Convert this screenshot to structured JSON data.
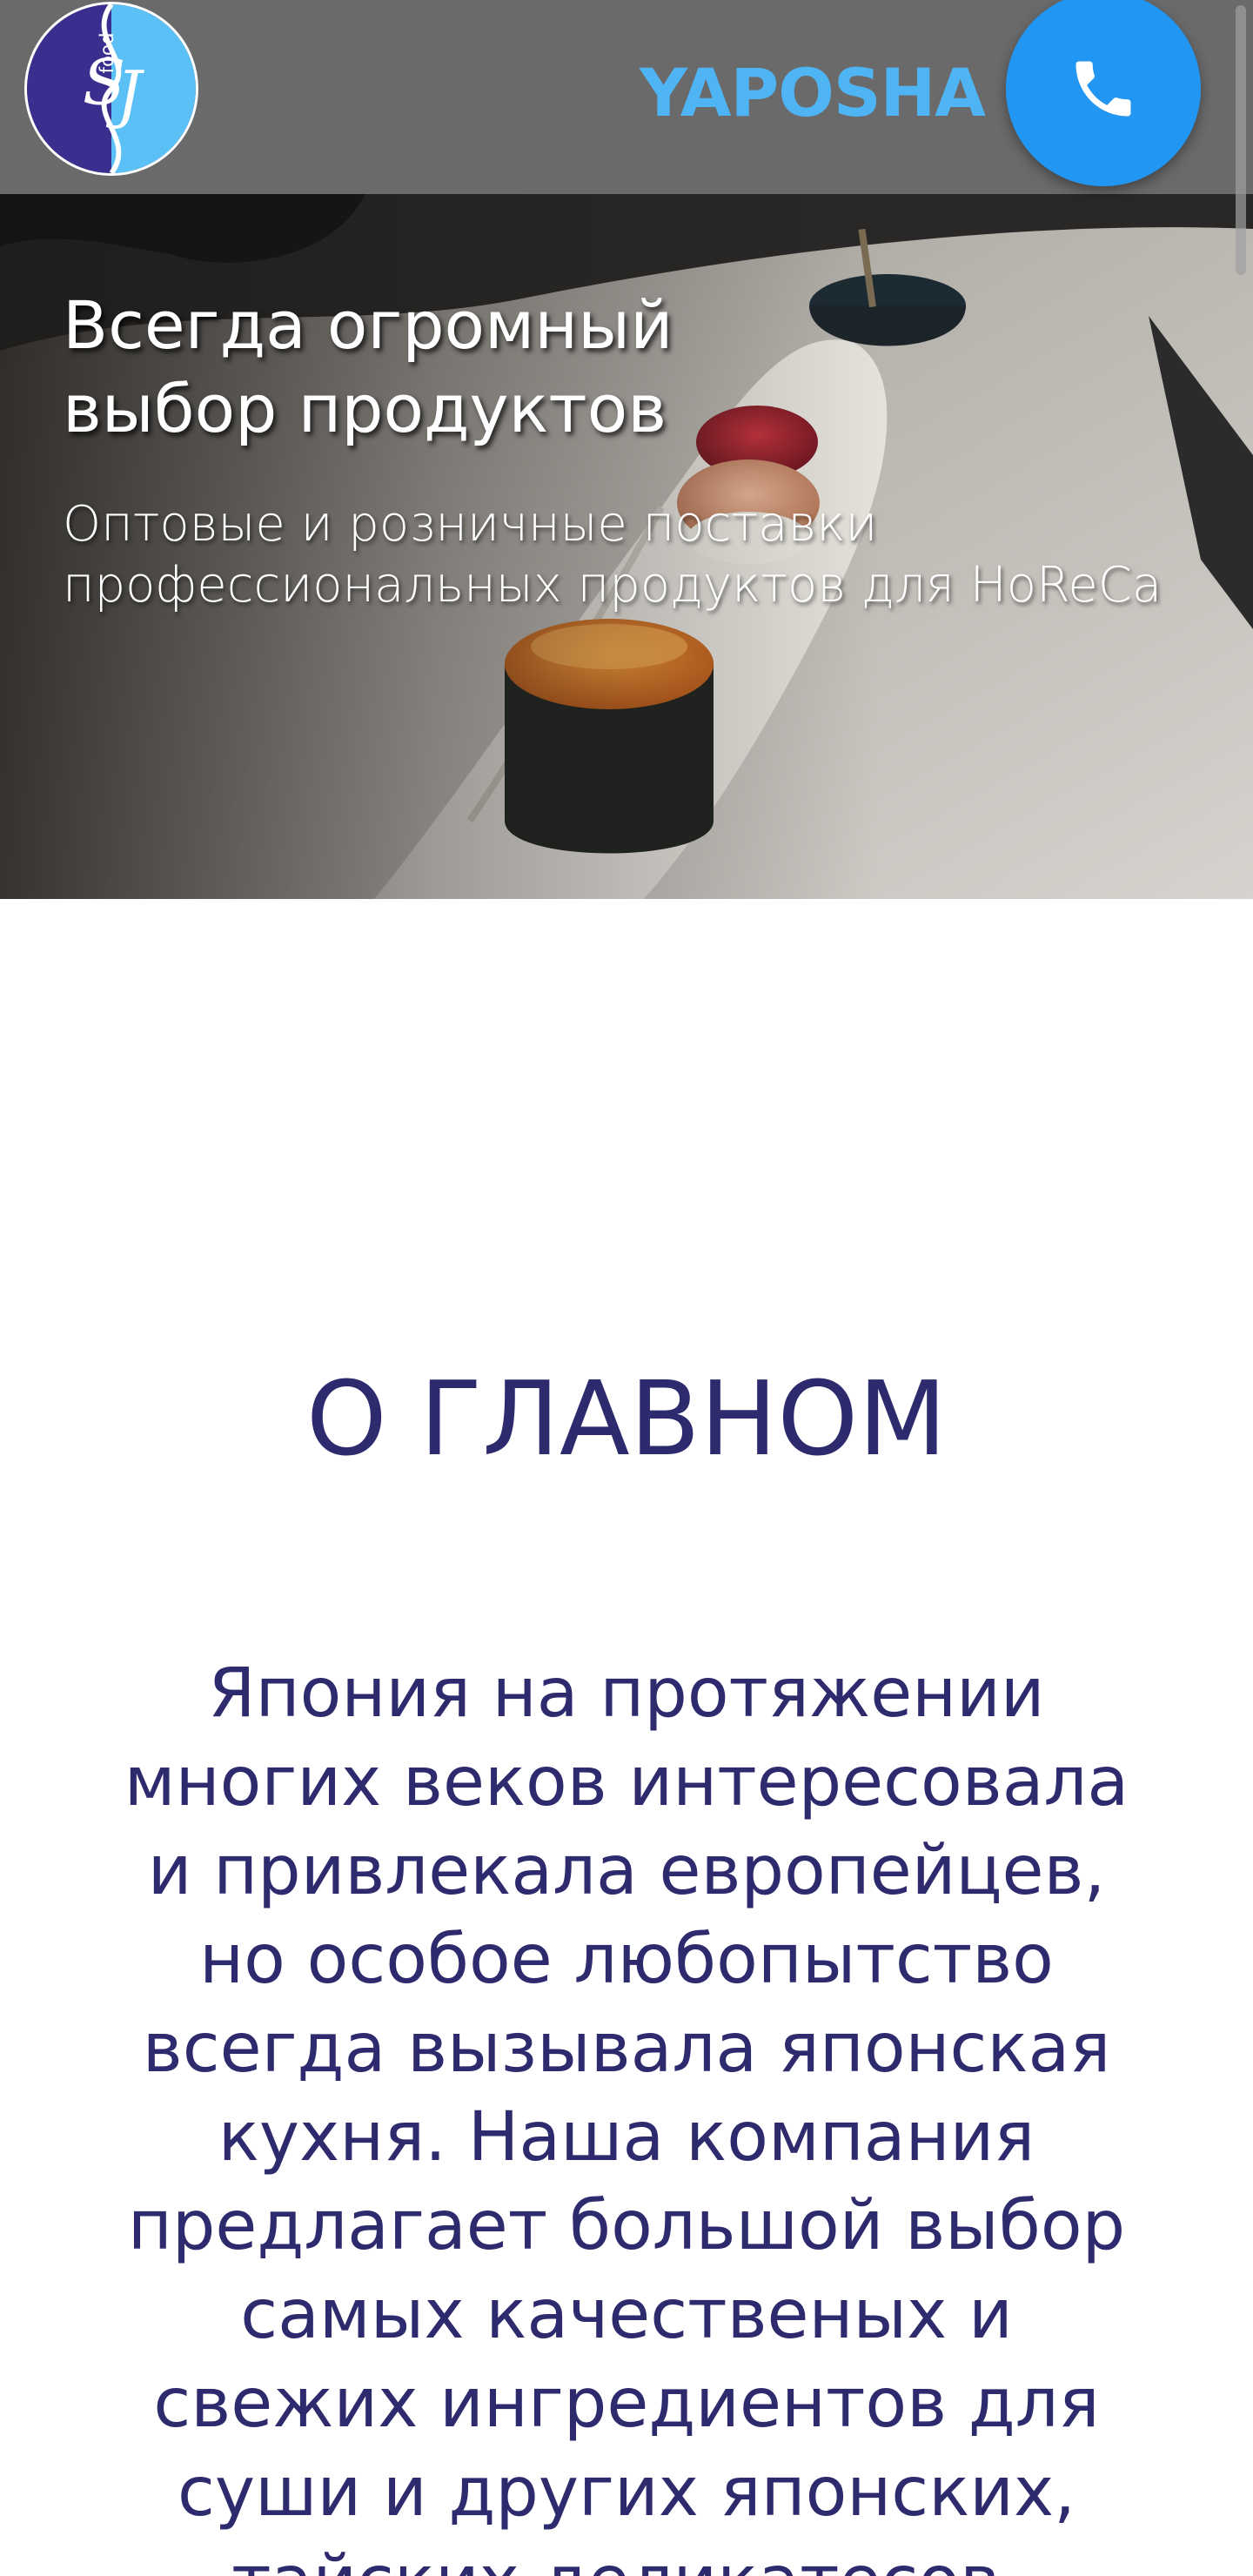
{
  "header": {
    "logo_text": "Food SJ",
    "brand": "YAPOSHA",
    "phone_icon": "phone-icon"
  },
  "hero": {
    "title": "Всегда огромный\nвыбор продуктов",
    "subtitle": "Оптовые и розничные поставки\nпрофессиональных продуктов для HoReCa"
  },
  "about": {
    "title": "О ГЛАВНОМ",
    "text": "Япония на протяжении\nмногих веков интересовала\nи привлекала европейцев,\nно особое любопытство\nвсегда вызывала японская\nкухня. Наша компания\nпредлагает большой выбор\nсамых качественых и\nсвежих ингредиентов для\nсуши и других японских,\nтайских деликатесов."
  },
  "colors": {
    "header_bg": "#6a6a6a",
    "brand": "#4fb4f4",
    "phone_button": "#2196f3",
    "heading": "#2e2a6e"
  }
}
